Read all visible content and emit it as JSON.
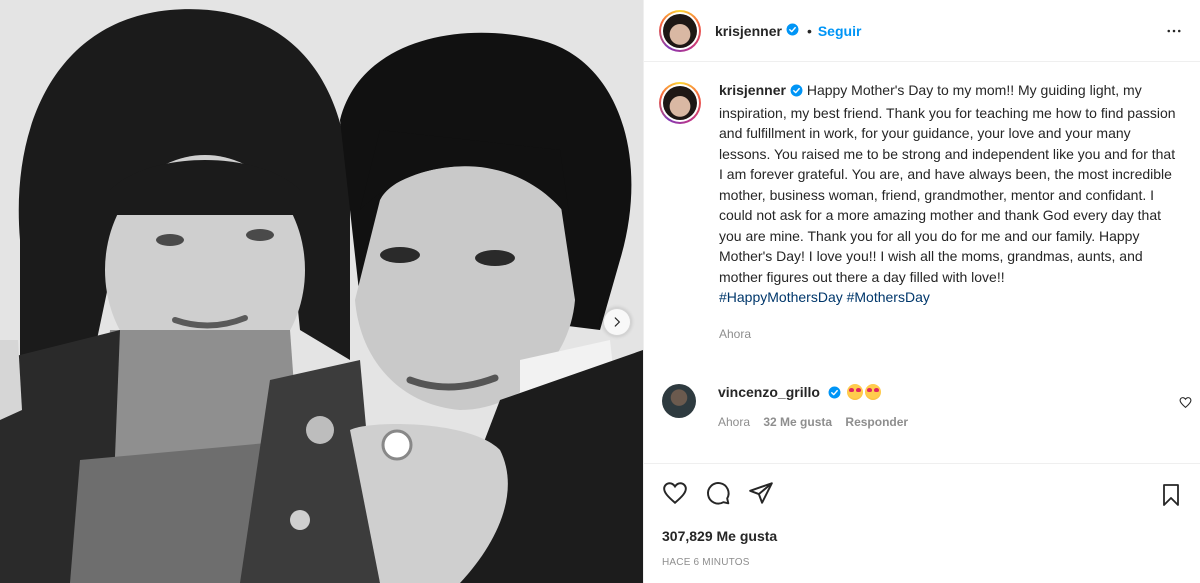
{
  "post": {
    "username": "krisjenner",
    "follow_label": "Seguir",
    "dot": "•",
    "caption_text": "Happy Mother's Day to my mom!! My guiding light, my inspiration, my best friend. Thank you for teaching me how to find passion and fulfillment in work, for your guidance, your love and your many lessons. You raised me to be strong and independent like you and for that I am forever grateful. You are, and have always been, the most incredible mother, business woman, friend, grandmother, mentor and confidant. I could not ask for a more amazing mother and thank God every day that you are mine. Thank you for all you do for me and our family. Happy Mother's Day! I love you!! I wish all the moms, grandmas, aunts, and mother figures out there a day filled with love!!",
    "hashtags": "#HappyMothersDay #MothersDay",
    "caption_time": "Ahora",
    "likes": "307,829 Me gusta",
    "posted_ago": "HACE 6 MINUTOS"
  },
  "comment": {
    "username": "vincenzo_grillo",
    "time": "Ahora",
    "likes": "32 Me gusta",
    "reply_label": "Responder"
  },
  "icons": {
    "more": "more-options-icon",
    "like": "heart-icon",
    "comment": "comment-icon",
    "share": "share-icon",
    "save": "bookmark-icon",
    "next": "chevron-right-icon",
    "verified": "verified-badge-icon",
    "emoji": "star-struck-emoji"
  },
  "colors": {
    "accent": "#0095f6",
    "hashtag": "#00376b",
    "muted": "#8e8e8e",
    "text": "#262626"
  }
}
